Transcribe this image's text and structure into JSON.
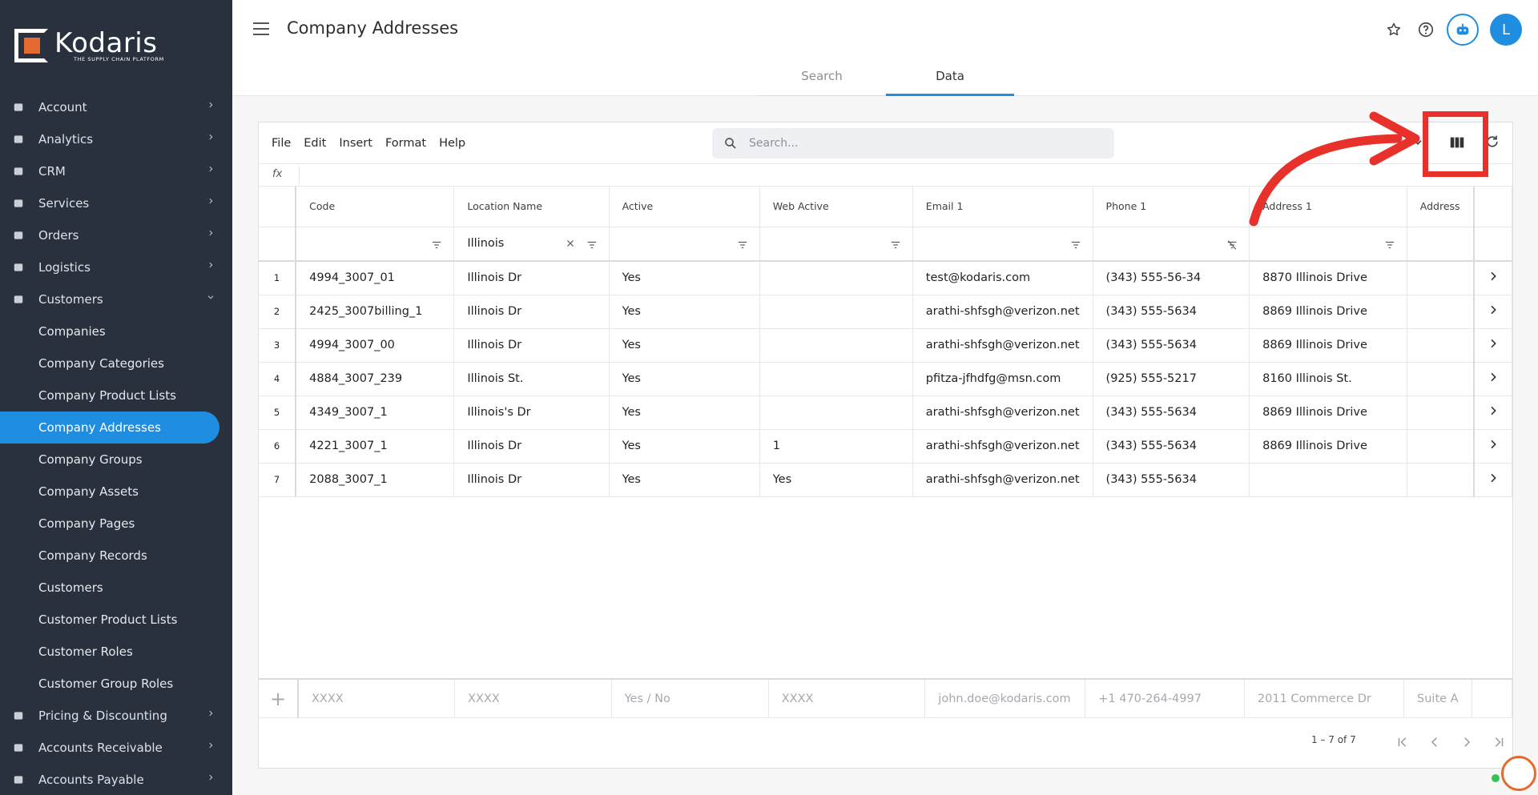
{
  "app": {
    "logo_name": "Kodaris",
    "logo_tagline": "THE SUPPLY CHAIN PLATFORM",
    "page_title": "Company Addresses",
    "avatar_letter": "L"
  },
  "sidebar": {
    "items": [
      {
        "label": "Account",
        "icon": "person-icon"
      },
      {
        "label": "Analytics",
        "icon": "analytics-icon"
      },
      {
        "label": "CRM",
        "icon": "contacts-icon"
      },
      {
        "label": "Services",
        "icon": "services-icon"
      },
      {
        "label": "Orders",
        "icon": "truck-icon"
      },
      {
        "label": "Logistics",
        "icon": "logistics-icon"
      },
      {
        "label": "Customers",
        "icon": "people-icon"
      }
    ],
    "customers_sub": [
      "Companies",
      "Company Categories",
      "Company Product Lists",
      "Company Addresses",
      "Company Groups",
      "Company Assets",
      "Company Pages",
      "Company Records",
      "Customers",
      "Customer Product Lists",
      "Customer Roles",
      "Customer Group Roles"
    ],
    "bottom_items": [
      {
        "label": "Pricing & Discounting",
        "icon": "dollar-icon"
      },
      {
        "label": "Accounts Receivable",
        "icon": "bank-icon"
      },
      {
        "label": "Accounts Payable",
        "icon": "bank-icon"
      }
    ],
    "active": "Company Addresses"
  },
  "tabs": [
    "Search",
    "Data"
  ],
  "active_tab": "Data",
  "toolbar": {
    "menus": [
      "File",
      "Edit",
      "Insert",
      "Format",
      "Help"
    ],
    "search_placeholder": "Search...",
    "fx_label": "fx"
  },
  "grid": {
    "columns": [
      "Code",
      "Location Name",
      "Active",
      "Web Active",
      "Email 1",
      "Phone 1",
      "Address 1",
      "Address"
    ],
    "filters": [
      "",
      "Illinois",
      "",
      "",
      "",
      "",
      "",
      ""
    ],
    "rows": [
      {
        "n": "1",
        "cells": [
          "4994_3007_01",
          "Illinois Dr",
          "Yes",
          "",
          "test@kodaris.com",
          "(343) 555-56-34",
          "8870 Illinois Drive",
          ""
        ]
      },
      {
        "n": "2",
        "cells": [
          "2425_3007billing_1",
          "Illinois Dr",
          "Yes",
          "",
          "arathi-shfsgh@verizon.net",
          "(343) 555-5634",
          "8869 Illinois Drive",
          ""
        ]
      },
      {
        "n": "3",
        "cells": [
          "4994_3007_00",
          "Illinois Dr",
          "Yes",
          "",
          "arathi-shfsgh@verizon.net",
          "(343) 555-5634",
          "8869 Illinois Drive",
          ""
        ]
      },
      {
        "n": "4",
        "cells": [
          "4884_3007_239",
          "Illinois St.",
          "Yes",
          "",
          "pfitza-jfhdfg@msn.com",
          "(925) 555-5217",
          "8160 Illinois St.",
          ""
        ]
      },
      {
        "n": "5",
        "cells": [
          "4349_3007_1",
          "Illinois's Dr",
          "Yes",
          "",
          "arathi-shfsgh@verizon.net",
          "(343) 555-5634",
          "8869 Illinois Drive",
          ""
        ]
      },
      {
        "n": "6",
        "cells": [
          "4221_3007_1",
          "Illinois Dr",
          "Yes",
          "1",
          "arathi-shfsgh@verizon.net",
          "(343) 555-5634",
          "8869 Illinois Drive",
          ""
        ]
      },
      {
        "n": "7",
        "cells": [
          "2088_3007_1",
          "Illinois Dr",
          "Yes",
          "Yes",
          "arathi-shfsgh@verizon.net",
          "(343) 555-5634",
          "",
          ""
        ]
      }
    ],
    "new_row_placeholders": [
      "XXXX",
      "XXXX",
      "Yes / No",
      "XXXX",
      "john.doe@kodaris.com",
      "+1 470-264-4997",
      "2011 Commerce Dr",
      "Suite A"
    ]
  },
  "pagination": {
    "range_text": "1 – 7 of 7"
  },
  "colors": {
    "sidebar_bg": "#28313d",
    "accent": "#1f8ee0",
    "annotation": "#e8312a",
    "brand_orange": "#e46a2f"
  }
}
